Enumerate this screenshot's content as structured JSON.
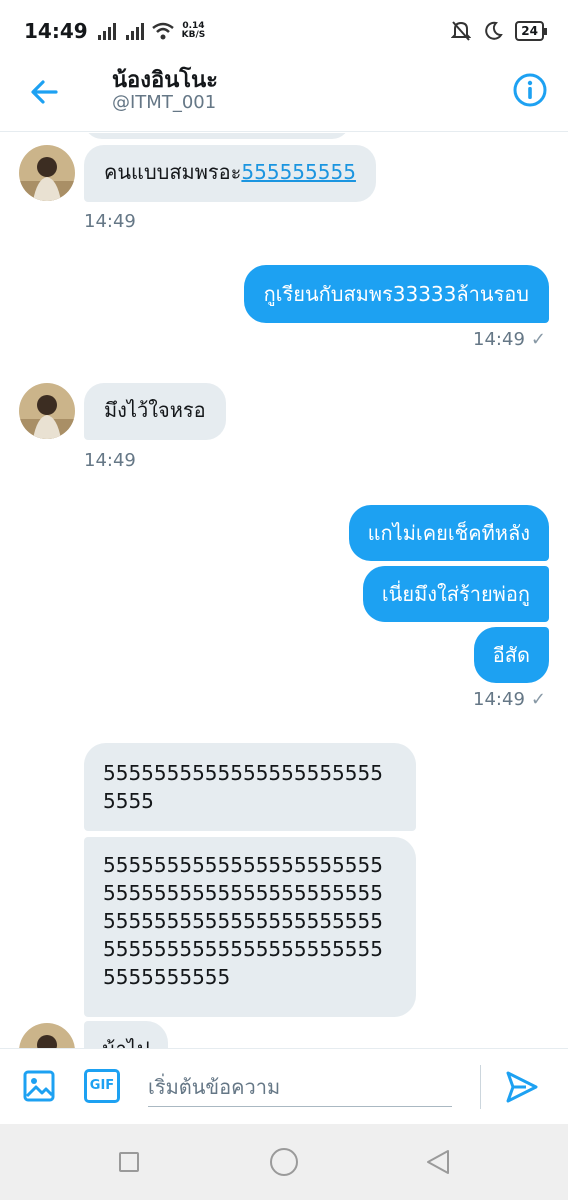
{
  "status_bar": {
    "time": "14:49",
    "net_speed": "0.14",
    "net_unit": "KB/S",
    "battery": "24"
  },
  "header": {
    "name": "น้องอินโนะ",
    "handle": "@ITMT_001"
  },
  "messages": {
    "m1_text": "คนแบบสมพรอะ",
    "m1_link": "555555555",
    "m1_time": "14:49",
    "m2_text": "กูเรียนกับสมพร33333ล้านรอบ",
    "m2_time": "14:49",
    "m3_text": "มึงไว้ใจหรอ",
    "m3_time": "14:49",
    "m4_text": "แกไม่เคยเช็คทีหลัง",
    "m5_text": "เนี่ยมึงใส่ร้ายพ่อกู",
    "m6_text": "อีสัด",
    "m6_time": "14:49",
    "m7_line1": "5555555555555555555555",
    "m7_line2": "5555",
    "m8_line1": "5555555555555555555555",
    "m8_line2": "5555555555555555555555",
    "m8_line3": "5555555555555555555555",
    "m8_line4": "5555555555555555555555",
    "m8_line5": "5555555555",
    "m9_text": "น้าไป"
  },
  "composer": {
    "gif_label": "GIF",
    "placeholder": "เริ่มต้นข้อความ"
  },
  "colors": {
    "accent": "#1da1f2",
    "incoming_bubble": "#e6ecf0",
    "secondary_text": "#657786"
  }
}
